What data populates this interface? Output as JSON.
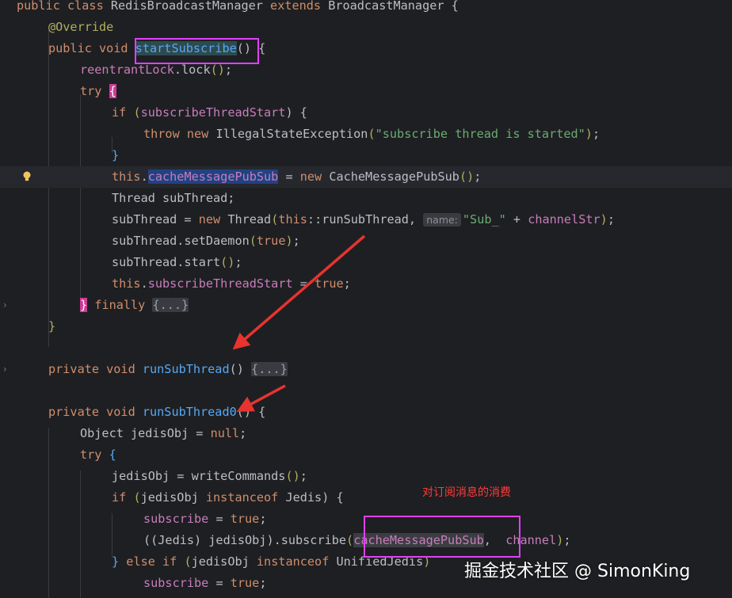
{
  "editor": {
    "lines": [
      [
        {
          "t": "public class ",
          "c": "kw"
        },
        {
          "t": "RedisBroadcastManager ",
          "c": "var"
        },
        {
          "t": "extends ",
          "c": "kw"
        },
        {
          "t": "BroadcastManager {",
          "c": "var"
        }
      ],
      [
        {
          "t": "@Override",
          "c": "ann"
        }
      ],
      [
        {
          "t": "public void ",
          "c": "kw"
        },
        {
          "t": "startSubscribe",
          "c": "fn hlword"
        },
        {
          "t": "() {",
          "c": "var"
        }
      ],
      [
        {
          "t": "reentrantLock",
          "c": "fld"
        },
        {
          "t": ".lock",
          "c": "var"
        },
        {
          "t": "()",
          "c": "ann"
        },
        {
          "t": ";",
          "c": "var"
        }
      ],
      [
        {
          "t": "try ",
          "c": "kw"
        },
        {
          "t": "{",
          "c": "pnk"
        }
      ],
      [
        {
          "t": "if ",
          "c": "kw"
        },
        {
          "t": "(",
          "c": "ann"
        },
        {
          "t": "subscribeThreadStart",
          "c": "fld"
        },
        {
          "t": ") {",
          "c": "var"
        }
      ],
      [
        {
          "t": "throw new ",
          "c": "kw"
        },
        {
          "t": "IllegalStateException",
          "c": "var"
        },
        {
          "t": "(",
          "c": "ann"
        },
        {
          "t": "\"subscribe thread is started\"",
          "c": "str"
        },
        {
          "t": ")",
          "c": "ann"
        },
        {
          "t": ";",
          "c": "var"
        }
      ],
      [
        {
          "t": "}",
          "c": "fn"
        }
      ],
      [
        {
          "t": "this",
          "c": "kw"
        },
        {
          "t": ".",
          "c": "var"
        },
        {
          "t": "cacheMessagePubSub",
          "c": "fld hlsel"
        },
        {
          "t": " = ",
          "c": "var"
        },
        {
          "t": "new ",
          "c": "kw"
        },
        {
          "t": "CacheMessagePubSub",
          "c": "var"
        },
        {
          "t": "()",
          "c": "ann"
        },
        {
          "t": ";",
          "c": "var"
        }
      ],
      [
        {
          "t": "Thread subThread;",
          "c": "var"
        }
      ],
      [
        {
          "t": "subThread = ",
          "c": "var"
        },
        {
          "t": "new ",
          "c": "kw"
        },
        {
          "t": "Thread",
          "c": "var"
        },
        {
          "t": "(",
          "c": "ann"
        },
        {
          "t": "this",
          "c": "kw"
        },
        {
          "t": "::runSubThread, ",
          "c": "var"
        },
        {
          "t": "name:",
          "c": "hint"
        },
        {
          "t": "\"Sub_\"",
          "c": "str"
        },
        {
          "t": " + ",
          "c": "var"
        },
        {
          "t": "channelStr",
          "c": "fld"
        },
        {
          "t": ")",
          "c": "ann"
        },
        {
          "t": ";",
          "c": "var"
        }
      ],
      [
        {
          "t": "subThread.setDaemon",
          "c": "var"
        },
        {
          "t": "(",
          "c": "ann"
        },
        {
          "t": "true",
          "c": "kw"
        },
        {
          "t": ")",
          "c": "ann"
        },
        {
          "t": ";",
          "c": "var"
        }
      ],
      [
        {
          "t": "subThread.start",
          "c": "var"
        },
        {
          "t": "()",
          "c": "ann"
        },
        {
          "t": ";",
          "c": "var"
        }
      ],
      [
        {
          "t": "this",
          "c": "kw"
        },
        {
          "t": ".",
          "c": "var"
        },
        {
          "t": "subscribeThreadStart",
          "c": "fld"
        },
        {
          "t": " = ",
          "c": "var"
        },
        {
          "t": "true",
          "c": "kw"
        },
        {
          "t": ";",
          "c": "var"
        }
      ],
      [
        {
          "t": "}",
          "c": "pnk"
        },
        {
          "t": " finally ",
          "c": "kw"
        },
        {
          "t": "{...}",
          "c": "fold"
        }
      ],
      [
        {
          "t": "}",
          "c": "ann"
        }
      ],
      [],
      [
        {
          "t": "private void ",
          "c": "kw"
        },
        {
          "t": "runSubThread",
          "c": "fn"
        },
        {
          "t": "() ",
          "c": "var"
        },
        {
          "t": "{...}",
          "c": "fold"
        }
      ],
      [],
      [
        {
          "t": "private void ",
          "c": "kw"
        },
        {
          "t": "runSubThread0",
          "c": "fn"
        },
        {
          "t": "() {",
          "c": "var"
        }
      ],
      [
        {
          "t": "Object jedisObj = ",
          "c": "var"
        },
        {
          "t": "null",
          "c": "kw"
        },
        {
          "t": ";",
          "c": "var"
        }
      ],
      [
        {
          "t": "try ",
          "c": "kw"
        },
        {
          "t": "{",
          "c": "fn"
        }
      ],
      [
        {
          "t": "jedisObj = writeCommands",
          "c": "var"
        },
        {
          "t": "()",
          "c": "ann"
        },
        {
          "t": ";",
          "c": "var"
        }
      ],
      [
        {
          "t": "if ",
          "c": "kw"
        },
        {
          "t": "(",
          "c": "ann"
        },
        {
          "t": "jedisObj ",
          "c": "var"
        },
        {
          "t": "instanceof ",
          "c": "kw"
        },
        {
          "t": "Jedis",
          "c": "var"
        },
        {
          "t": ") {",
          "c": "var"
        }
      ],
      [
        {
          "t": "subscribe",
          "c": "fld"
        },
        {
          "t": " = ",
          "c": "var"
        },
        {
          "t": "true",
          "c": "kw"
        },
        {
          "t": ";",
          "c": "var"
        }
      ],
      [
        {
          "t": "((Jedis) jedisObj)",
          "c": "var"
        },
        {
          "t": ".subscribe",
          "c": "var"
        },
        {
          "t": "(",
          "c": "ann"
        },
        {
          "t": "cacheMessagePubSub",
          "c": "fld hlgray"
        },
        {
          "t": ",  ",
          "c": "var"
        },
        {
          "t": "channel",
          "c": "fld"
        },
        {
          "t": ")",
          "c": "ann"
        },
        {
          "t": ";",
          "c": "var"
        }
      ],
      [
        {
          "t": "} ",
          "c": "fn"
        },
        {
          "t": "else if ",
          "c": "kw"
        },
        {
          "t": "(",
          "c": "ann"
        },
        {
          "t": "jedisObj ",
          "c": "var"
        },
        {
          "t": "instanceof ",
          "c": "kw"
        },
        {
          "t": "UnifiedJedis",
          "c": "var"
        },
        {
          "t": ")",
          "c": "ann"
        }
      ],
      [
        {
          "t": "subscribe",
          "c": "fld"
        },
        {
          "t": " = ",
          "c": "var"
        },
        {
          "t": "true",
          "c": "kw"
        },
        {
          "t": ";",
          "c": "var"
        }
      ]
    ]
  },
  "annotation": {
    "note": "对订阅消息的消费"
  },
  "watermark": "掘金技术社区 @ SimonKing",
  "colors": {
    "background": "#1e1f22",
    "keyword": "#cf8e6d",
    "method": "#56a8f5",
    "field": "#c77dbb",
    "string": "#6aab73",
    "annotation_box": "#e040fb",
    "arrow": "#e8332f"
  }
}
